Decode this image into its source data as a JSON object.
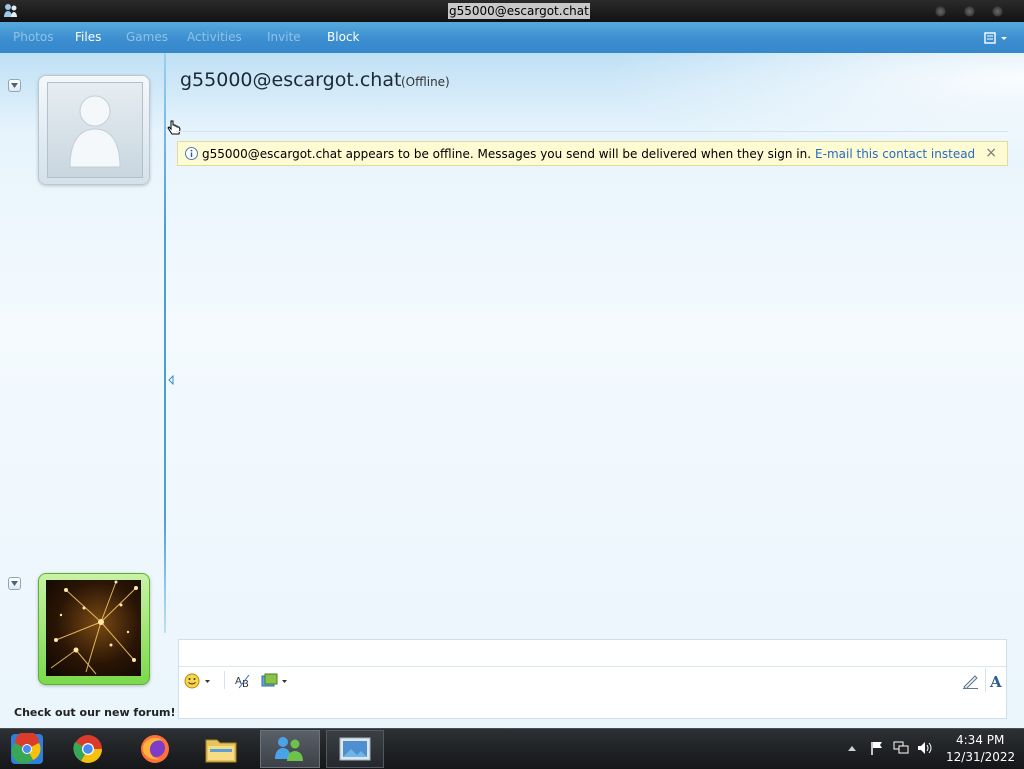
{
  "window": {
    "title": "g55000@escargot.chat"
  },
  "menu": {
    "items": [
      {
        "label": "Photos",
        "enabled": false
      },
      {
        "label": "Files",
        "enabled": true
      },
      {
        "label": "Games",
        "enabled": false
      },
      {
        "label": "Activities",
        "enabled": false
      },
      {
        "label": "Invite",
        "enabled": false
      },
      {
        "label": "Block",
        "enabled": true
      }
    ]
  },
  "contact": {
    "name": "g55000@escargot.chat",
    "status": "(Offline)"
  },
  "notice": {
    "text": "g55000@escargot.chat appears to be offline. Messages you send will be delivered when they sign in.",
    "link": "E-mail this contact instead",
    "close": "×"
  },
  "promo": {
    "text": "Check out our new forum!"
  },
  "taskbar": {
    "time": "4:34 PM",
    "date": "12/31/2022"
  },
  "colors": {
    "menu_bar": "#3c8ed0",
    "notice_bg": "#fdfbd1",
    "link": "#2a6ac6"
  }
}
